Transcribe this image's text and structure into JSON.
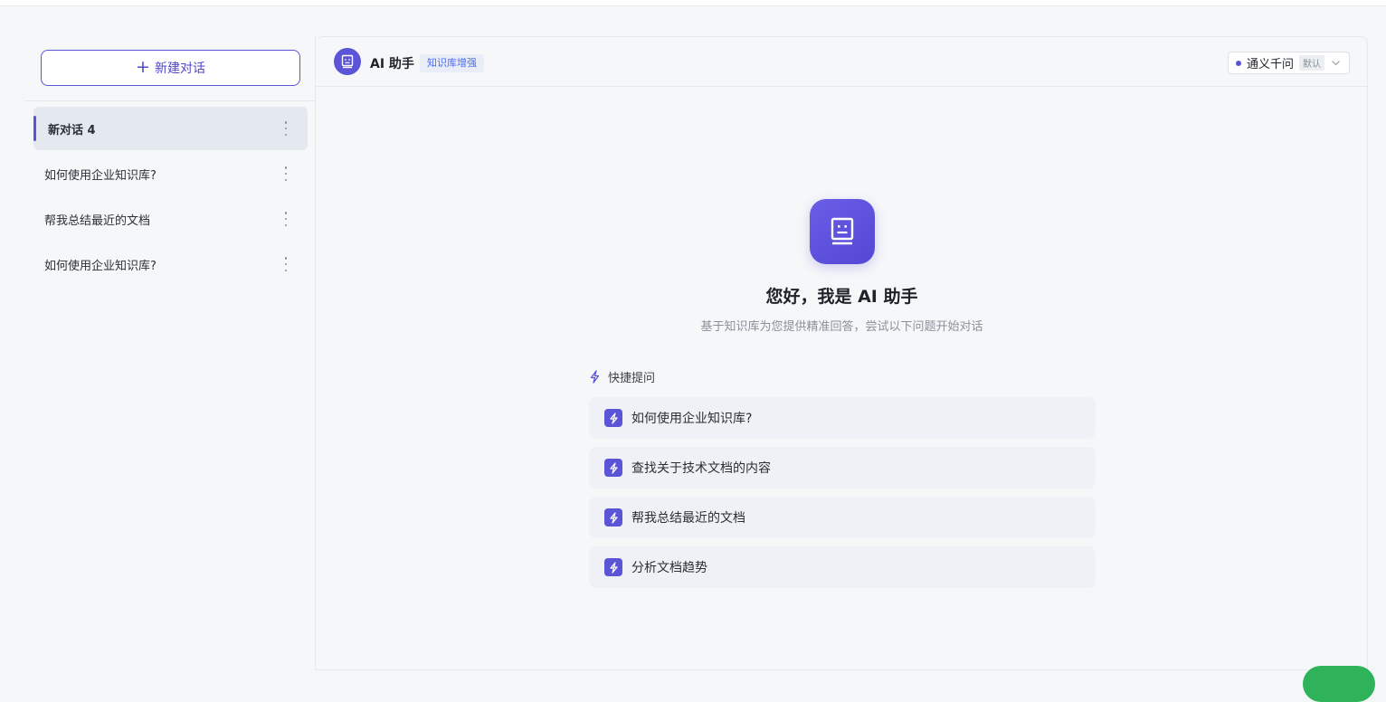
{
  "sidebar": {
    "new_chat_label": "新建对话",
    "conversations": [
      {
        "title": "新对话 4",
        "active": true
      },
      {
        "title": "如何使用企业知识库?",
        "active": false
      },
      {
        "title": "帮我总结最近的文档",
        "active": false
      },
      {
        "title": "如何使用企业知识库?",
        "active": false
      }
    ]
  },
  "header": {
    "title": "AI 助手",
    "tag": "知识库增强",
    "model": {
      "name": "通义千问",
      "default_tag": "默认"
    }
  },
  "welcome": {
    "title": "您好，我是 AI 助手",
    "subtitle": "基于知识库为您提供精准回答，尝试以下问题开始对话",
    "quick_label": "快捷提问",
    "questions": [
      "如何使用企业知识库?",
      "查找关于技术文档的内容",
      "帮我总结最近的文档",
      "分析文档趋势"
    ]
  },
  "colors": {
    "accent": "#5b54d6",
    "tag_blue": "#4c6ef5",
    "float_green": "#2fb35a"
  },
  "icons": {
    "avatar": "robot-icon",
    "quick": "lightning-icon",
    "more": "more-vertical-icon",
    "plus": "plus-icon",
    "dropdown": "chevron-down-icon"
  }
}
